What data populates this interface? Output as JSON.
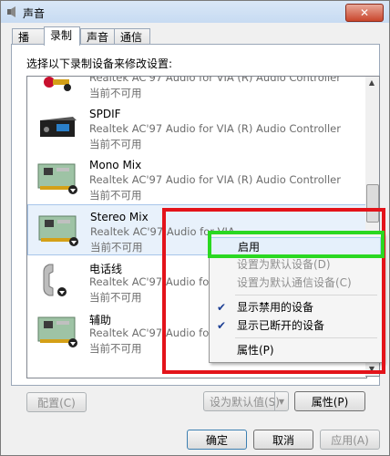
{
  "window": {
    "title": "声音",
    "close_glyph": "✕",
    "icon": "speaker-icon"
  },
  "tabs": [
    {
      "label": "播放",
      "active": false
    },
    {
      "label": "录制",
      "active": true
    },
    {
      "label": "声音",
      "active": false
    },
    {
      "label": "通信",
      "active": false
    }
  ],
  "instruction": "选择以下录制设备来修改设置:",
  "devices": [
    {
      "name": "",
      "description": "Realtek AC'97 Audio for VIA (R) Audio Controller",
      "status": "当前不可用",
      "icon": "rca-plug-icon"
    },
    {
      "name": "SPDIF",
      "description": "Realtek AC'97 Audio for VIA (R) Audio Controller",
      "status": "当前不可用",
      "icon": "spdif-device-icon"
    },
    {
      "name": "Mono Mix",
      "description": "Realtek AC'97 Audio for VIA (R) Audio Controller",
      "status": "当前不可用",
      "icon": "sound-card-icon"
    },
    {
      "name": "Stereo Mix",
      "description": "Realtek AC'97 Audio for VIA",
      "status": "当前不可用",
      "icon": "sound-card-icon",
      "selected": true
    },
    {
      "name": "电话线",
      "description": "Realtek AC'97 Audio for VIA",
      "status": "当前不可用",
      "icon": "telephone-icon"
    },
    {
      "name": "辅助",
      "description": "Realtek AC'97 Audio for VIA",
      "status": "当前不可用",
      "icon": "sound-card-icon"
    }
  ],
  "buttons": {
    "configure": "配置(C)",
    "set_default": "设为默认值(S)",
    "properties": "属性(P)",
    "ok": "确定",
    "cancel": "取消",
    "apply": "应用(A)"
  },
  "context_menu": {
    "items": [
      {
        "label": "启用",
        "enabled": true,
        "checked": false,
        "highlighted": true
      },
      {
        "label": "设置为默认设备(D)",
        "enabled": false,
        "checked": false
      },
      {
        "label": "设置为默认通信设备(C)",
        "enabled": false,
        "checked": false
      },
      {
        "label": "显示禁用的设备",
        "enabled": true,
        "checked": true
      },
      {
        "label": "显示已断开的设备",
        "enabled": true,
        "checked": true
      },
      {
        "label": "属性(P)",
        "enabled": true,
        "checked": false
      }
    ],
    "check_glyph": "✔"
  },
  "colors": {
    "annotation_red": "#e3131a",
    "annotation_green": "#2ad821",
    "selection_bg": "#e8f1fb",
    "disabled_text": "#8f8f8f"
  }
}
